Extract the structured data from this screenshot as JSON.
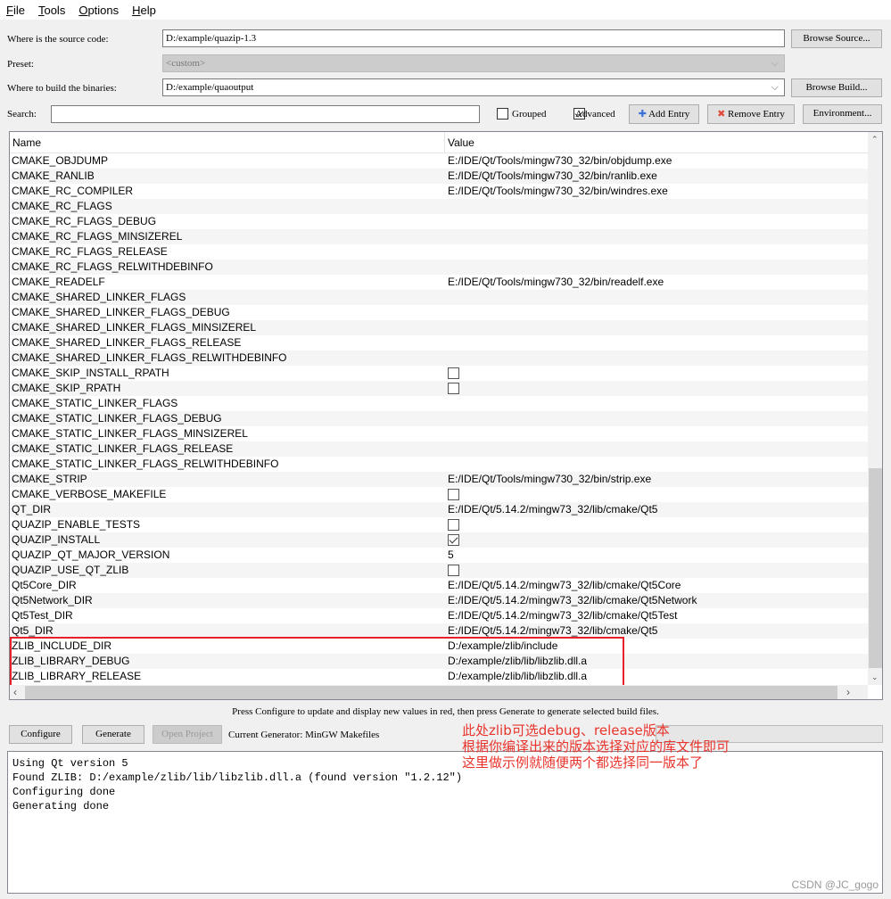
{
  "menu": [
    "File",
    "Tools",
    "Options",
    "Help"
  ],
  "source": {
    "label": "Where is the source code:",
    "value": "D:/example/quazip-1.3",
    "browse": "Browse Source..."
  },
  "preset": {
    "label": "Preset:",
    "value": "<custom>"
  },
  "build": {
    "label": "Where to build the binaries:",
    "value": "D:/example/quaoutput",
    "browse": "Browse Build..."
  },
  "search": {
    "label": "Search:",
    "value": ""
  },
  "grouped": {
    "label": "Grouped",
    "checked": false
  },
  "advanced": {
    "label": "Advanced",
    "checked": true
  },
  "add_entry": "Add Entry",
  "remove_entry": "Remove Entry",
  "environment": "Environment...",
  "table": {
    "headers": [
      "Name",
      "Value"
    ],
    "rows": [
      {
        "name": "CMAKE_OBJDUMP",
        "value": "E:/IDE/Qt/Tools/mingw730_32/bin/objdump.exe"
      },
      {
        "name": "CMAKE_RANLIB",
        "value": "E:/IDE/Qt/Tools/mingw730_32/bin/ranlib.exe"
      },
      {
        "name": "CMAKE_RC_COMPILER",
        "value": "E:/IDE/Qt/Tools/mingw730_32/bin/windres.exe"
      },
      {
        "name": "CMAKE_RC_FLAGS",
        "value": ""
      },
      {
        "name": "CMAKE_RC_FLAGS_DEBUG",
        "value": ""
      },
      {
        "name": "CMAKE_RC_FLAGS_MINSIZEREL",
        "value": ""
      },
      {
        "name": "CMAKE_RC_FLAGS_RELEASE",
        "value": ""
      },
      {
        "name": "CMAKE_RC_FLAGS_RELWITHDEBINFO",
        "value": ""
      },
      {
        "name": "CMAKE_READELF",
        "value": "E:/IDE/Qt/Tools/mingw730_32/bin/readelf.exe"
      },
      {
        "name": "CMAKE_SHARED_LINKER_FLAGS",
        "value": ""
      },
      {
        "name": "CMAKE_SHARED_LINKER_FLAGS_DEBUG",
        "value": ""
      },
      {
        "name": "CMAKE_SHARED_LINKER_FLAGS_MINSIZEREL",
        "value": ""
      },
      {
        "name": "CMAKE_SHARED_LINKER_FLAGS_RELEASE",
        "value": ""
      },
      {
        "name": "CMAKE_SHARED_LINKER_FLAGS_RELWITHDEBINFO",
        "value": ""
      },
      {
        "name": "CMAKE_SKIP_INSTALL_RPATH",
        "checkbox": false
      },
      {
        "name": "CMAKE_SKIP_RPATH",
        "checkbox": false
      },
      {
        "name": "CMAKE_STATIC_LINKER_FLAGS",
        "value": ""
      },
      {
        "name": "CMAKE_STATIC_LINKER_FLAGS_DEBUG",
        "value": ""
      },
      {
        "name": "CMAKE_STATIC_LINKER_FLAGS_MINSIZEREL",
        "value": ""
      },
      {
        "name": "CMAKE_STATIC_LINKER_FLAGS_RELEASE",
        "value": ""
      },
      {
        "name": "CMAKE_STATIC_LINKER_FLAGS_RELWITHDEBINFO",
        "value": ""
      },
      {
        "name": "CMAKE_STRIP",
        "value": "E:/IDE/Qt/Tools/mingw730_32/bin/strip.exe"
      },
      {
        "name": "CMAKE_VERBOSE_MAKEFILE",
        "checkbox": false
      },
      {
        "name": "QT_DIR",
        "value": "E:/IDE/Qt/5.14.2/mingw73_32/lib/cmake/Qt5"
      },
      {
        "name": "QUAZIP_ENABLE_TESTS",
        "checkbox": false
      },
      {
        "name": "QUAZIP_INSTALL",
        "checkbox": true
      },
      {
        "name": "QUAZIP_QT_MAJOR_VERSION",
        "value": "5"
      },
      {
        "name": "QUAZIP_USE_QT_ZLIB",
        "checkbox": false
      },
      {
        "name": "Qt5Core_DIR",
        "value": "E:/IDE/Qt/5.14.2/mingw73_32/lib/cmake/Qt5Core"
      },
      {
        "name": "Qt5Network_DIR",
        "value": "E:/IDE/Qt/5.14.2/mingw73_32/lib/cmake/Qt5Network"
      },
      {
        "name": "Qt5Test_DIR",
        "value": "E:/IDE/Qt/5.14.2/mingw73_32/lib/cmake/Qt5Test"
      },
      {
        "name": "Qt5_DIR",
        "value": "E:/IDE/Qt/5.14.2/mingw73_32/lib/cmake/Qt5"
      },
      {
        "name": "ZLIB_INCLUDE_DIR",
        "value": "D:/example/zlib/include"
      },
      {
        "name": "ZLIB_LIBRARY_DEBUG",
        "value": "D:/example/zlib/lib/libzlib.dll.a"
      },
      {
        "name": "ZLIB_LIBRARY_RELEASE",
        "value": "D:/example/zlib/lib/libzlib.dll.a"
      }
    ]
  },
  "hint": "Press Configure to update and display new values in red, then press Generate to generate selected build files.",
  "configure": "Configure",
  "generate": "Generate",
  "open_project": "Open Project",
  "generator": "Current Generator: MinGW Makefiles",
  "log": [
    "Using Qt version 5",
    "Found ZLIB: D:/example/zlib/lib/libzlib.dll.a (found version \"1.2.12\")",
    "Configuring done",
    "Generating done"
  ],
  "annotation": [
    "此处zlib可选debug、release版本",
    "根据你编译出来的版本选择对应的库文件即可",
    "这里做示例就随便两个都选择同一版本了"
  ],
  "highlight_color": "#e8202a",
  "watermark": "CSDN @JC_gogo"
}
